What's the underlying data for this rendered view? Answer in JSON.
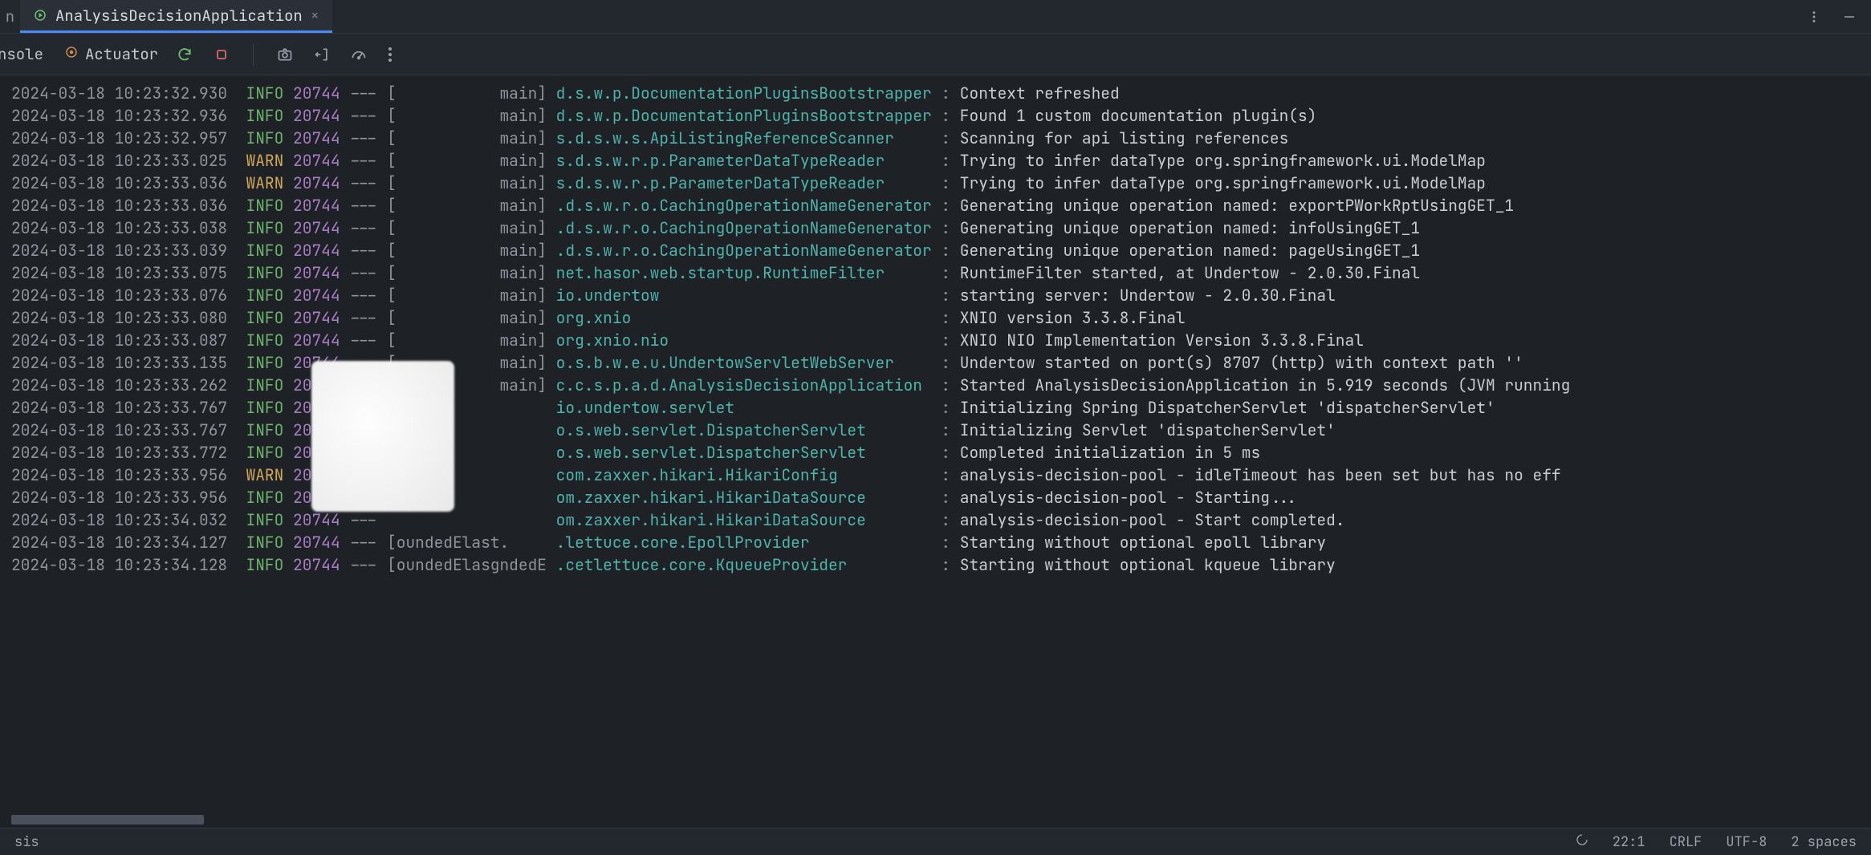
{
  "tab": {
    "title": "AnalysisDecisionApplication"
  },
  "toolbar": {
    "console_stub": "nsole",
    "actuator_label": "Actuator"
  },
  "colors": {
    "info": "#6db26d",
    "warn": "#d0a758",
    "pid": "#a97cc3",
    "logger": "#4fb2ab",
    "text": "#c9ccd1"
  },
  "log": {
    "level_pad": 4,
    "logger_pad": 40,
    "lines": [
      {
        "ts": "2024-03-18 10:23:32.930",
        "lvl": "INFO",
        "pid": "20744",
        "thr": "[           main]",
        "logger": "d.s.w.p.DocumentationPluginsBootstrapper",
        "msg": "Context refreshed"
      },
      {
        "ts": "2024-03-18 10:23:32.936",
        "lvl": "INFO",
        "pid": "20744",
        "thr": "[           main]",
        "logger": "d.s.w.p.DocumentationPluginsBootstrapper",
        "msg": "Found 1 custom documentation plugin(s)"
      },
      {
        "ts": "2024-03-18 10:23:32.957",
        "lvl": "INFO",
        "pid": "20744",
        "thr": "[           main]",
        "logger": "s.d.s.w.s.ApiListingReferenceScanner",
        "msg": "Scanning for api listing references"
      },
      {
        "ts": "2024-03-18 10:23:33.025",
        "lvl": "WARN",
        "pid": "20744",
        "thr": "[           main]",
        "logger": "s.d.s.w.r.p.ParameterDataTypeReader",
        "msg": "Trying to infer dataType org.springframework.ui.ModelMap"
      },
      {
        "ts": "2024-03-18 10:23:33.036",
        "lvl": "WARN",
        "pid": "20744",
        "thr": "[           main]",
        "logger": "s.d.s.w.r.p.ParameterDataTypeReader",
        "msg": "Trying to infer dataType org.springframework.ui.ModelMap"
      },
      {
        "ts": "2024-03-18 10:23:33.036",
        "lvl": "INFO",
        "pid": "20744",
        "thr": "[           main]",
        "logger": ".d.s.w.r.o.CachingOperationNameGenerator",
        "msg": "Generating unique operation named: exportPWorkRptUsingGET_1"
      },
      {
        "ts": "2024-03-18 10:23:33.038",
        "lvl": "INFO",
        "pid": "20744",
        "thr": "[           main]",
        "logger": ".d.s.w.r.o.CachingOperationNameGenerator",
        "msg": "Generating unique operation named: infoUsingGET_1"
      },
      {
        "ts": "2024-03-18 10:23:33.039",
        "lvl": "INFO",
        "pid": "20744",
        "thr": "[           main]",
        "logger": ".d.s.w.r.o.CachingOperationNameGenerator",
        "msg": "Generating unique operation named: pageUsingGET_1"
      },
      {
        "ts": "2024-03-18 10:23:33.075",
        "lvl": "INFO",
        "pid": "20744",
        "thr": "[           main]",
        "logger": "net.hasor.web.startup.RuntimeFilter",
        "msg": "RuntimeFilter started, at Undertow - 2.0.30.Final"
      },
      {
        "ts": "2024-03-18 10:23:33.076",
        "lvl": "INFO",
        "pid": "20744",
        "thr": "[           main]",
        "logger": "io.undertow",
        "msg": "starting server: Undertow - 2.0.30.Final"
      },
      {
        "ts": "2024-03-18 10:23:33.080",
        "lvl": "INFO",
        "pid": "20744",
        "thr": "[           main]",
        "logger": "org.xnio",
        "msg": "XNIO version 3.3.8.Final"
      },
      {
        "ts": "2024-03-18 10:23:33.087",
        "lvl": "INFO",
        "pid": "20744",
        "thr": "[           main]",
        "logger": "org.xnio.nio",
        "msg": "XNIO NIO Implementation Version 3.3.8.Final"
      },
      {
        "ts": "2024-03-18 10:23:33.135",
        "lvl": "INFO",
        "pid": "20744",
        "thr": "[           main]",
        "logger": "o.s.b.w.e.u.UndertowServletWebServer",
        "msg": "Undertow started on port(s) 8707 (http) with context path ''"
      },
      {
        "ts": "2024-03-18 10:23:33.262",
        "lvl": "INFO",
        "pid": "20744",
        "thr": "[           main]",
        "logger": "c.c.s.p.a.d.AnalysisDecisionApplication",
        "msg": "Started AnalysisDecisionApplication in 5.919 seconds (JVM running"
      },
      {
        "ts": "2024-03-18 10:23:33.767",
        "lvl": "INFO",
        "pid": "20744",
        "thr": "                 ",
        "logger": "io.undertow.servlet",
        "msg": "Initializing Spring DispatcherServlet 'dispatcherServlet'"
      },
      {
        "ts": "2024-03-18 10:23:33.767",
        "lvl": "INFO",
        "pid": "20744",
        "thr": "                 ",
        "logger": "o.s.web.servlet.DispatcherServlet",
        "msg": "Initializing Servlet 'dispatcherServlet'"
      },
      {
        "ts": "2024-03-18 10:23:33.772",
        "lvl": "INFO",
        "pid": "20744",
        "thr": "                 ",
        "logger": "o.s.web.servlet.DispatcherServlet",
        "msg": "Completed initialization in 5 ms"
      },
      {
        "ts": "2024-03-18 10:23:33.956",
        "lvl": "WARN",
        "pid": "20744",
        "thr": "                 ",
        "logger": "com.zaxxer.hikari.HikariConfig",
        "msg": "analysis-decision-pool - idleTimeout has been set but has no eff"
      },
      {
        "ts": "2024-03-18 10:23:33.956",
        "lvl": "INFO",
        "pid": "20744",
        "thr": "                 ",
        "logger": "om.zaxxer.hikari.HikariDataSource",
        "msg": "analysis-decision-pool - Starting..."
      },
      {
        "ts": "2024-03-18 10:23:34.032",
        "lvl": "INFO",
        "pid": "20744",
        "thr": "                 ",
        "logger": "om.zaxxer.hikari.HikariDataSource",
        "msg": "analysis-decision-pool - Start completed."
      },
      {
        "ts": "2024-03-18 10:23:34.127",
        "lvl": "INFO",
        "pid": "20744",
        "thr": "[oundedElast.    ",
        "logger": ".lettuce.core.EpollProvider",
        "msg": "Starting without optional epoll library"
      },
      {
        "ts": "2024-03-18 10:23:34.128",
        "lvl": "INFO",
        "pid": "20744",
        "thr": "[oundedElasgndedE",
        "logger": ".cetlettuce.core.KqueueProvider",
        "msg": "Starting without optional kqueue library"
      }
    ]
  },
  "status": {
    "left": "sis",
    "pos": "22:1",
    "eol": "CRLF",
    "enc": "UTF-8",
    "indent": "2 spaces"
  }
}
